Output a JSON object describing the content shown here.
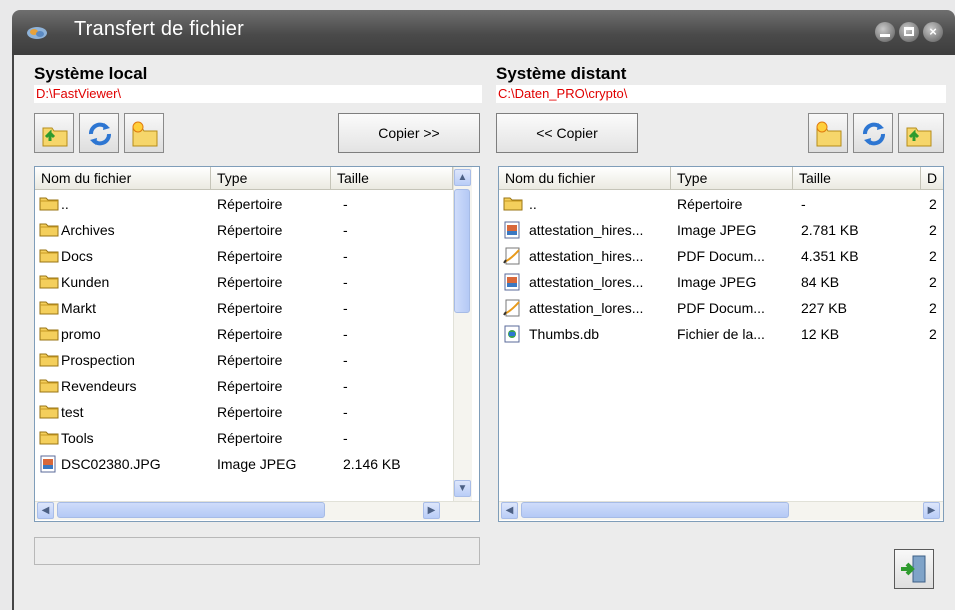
{
  "window": {
    "title": "Transfert de fichier"
  },
  "local": {
    "title": "Système local",
    "path": "D:\\FastViewer\\",
    "copy_label": "Copier >>",
    "columns": [
      "Nom du fichier",
      "Type",
      "Taille"
    ],
    "rows": [
      {
        "name": "..",
        "type": "Répertoire",
        "size": "-",
        "icon": "folder-icon"
      },
      {
        "name": "Archives",
        "type": "Répertoire",
        "size": "-",
        "icon": "folder-icon"
      },
      {
        "name": "Docs",
        "type": "Répertoire",
        "size": "-",
        "icon": "folder-icon"
      },
      {
        "name": "Kunden",
        "type": "Répertoire",
        "size": "-",
        "icon": "folder-icon"
      },
      {
        "name": "Markt",
        "type": "Répertoire",
        "size": "-",
        "icon": "folder-icon"
      },
      {
        "name": "promo",
        "type": "Répertoire",
        "size": "-",
        "icon": "folder-icon"
      },
      {
        "name": "Prospection",
        "type": "Répertoire",
        "size": "-",
        "icon": "folder-icon"
      },
      {
        "name": "Revendeurs",
        "type": "Répertoire",
        "size": "-",
        "icon": "folder-icon"
      },
      {
        "name": "test",
        "type": "Répertoire",
        "size": "-",
        "icon": "folder-icon"
      },
      {
        "name": "Tools",
        "type": "Répertoire",
        "size": "-",
        "icon": "folder-icon"
      },
      {
        "name": "DSC02380.JPG",
        "type": "Image JPEG",
        "size": "2.146 KB",
        "icon": "jpeg-file-icon"
      }
    ]
  },
  "remote": {
    "title": "Système distant",
    "path": "C:\\Daten_PRO\\crypto\\",
    "copy_label": "<< Copier",
    "columns": [
      "Nom du fichier",
      "Type",
      "Taille",
      "D"
    ],
    "rows": [
      {
        "name": "..",
        "type": "Répertoire",
        "size": "-",
        "date": "2",
        "icon": "folder-icon"
      },
      {
        "name": "attestation_hires...",
        "type": "Image JPEG",
        "size": "2.781 KB",
        "date": "2",
        "icon": "jpeg-file-icon"
      },
      {
        "name": "attestation_hires...",
        "type": "PDF Docum...",
        "size": "4.351 KB",
        "date": "2",
        "icon": "pdf-file-icon"
      },
      {
        "name": "attestation_lores...",
        "type": "Image JPEG",
        "size": "84 KB",
        "date": "2",
        "icon": "jpeg-file-icon"
      },
      {
        "name": "attestation_lores...",
        "type": "PDF Docum...",
        "size": "227 KB",
        "date": "2",
        "icon": "pdf-file-icon"
      },
      {
        "name": "Thumbs.db",
        "type": "Fichier de la...",
        "size": "12 KB",
        "date": "2",
        "icon": "db-file-icon"
      }
    ]
  },
  "colors": {
    "path_text": "#e00000",
    "titlebar": "#4a4a4a"
  }
}
